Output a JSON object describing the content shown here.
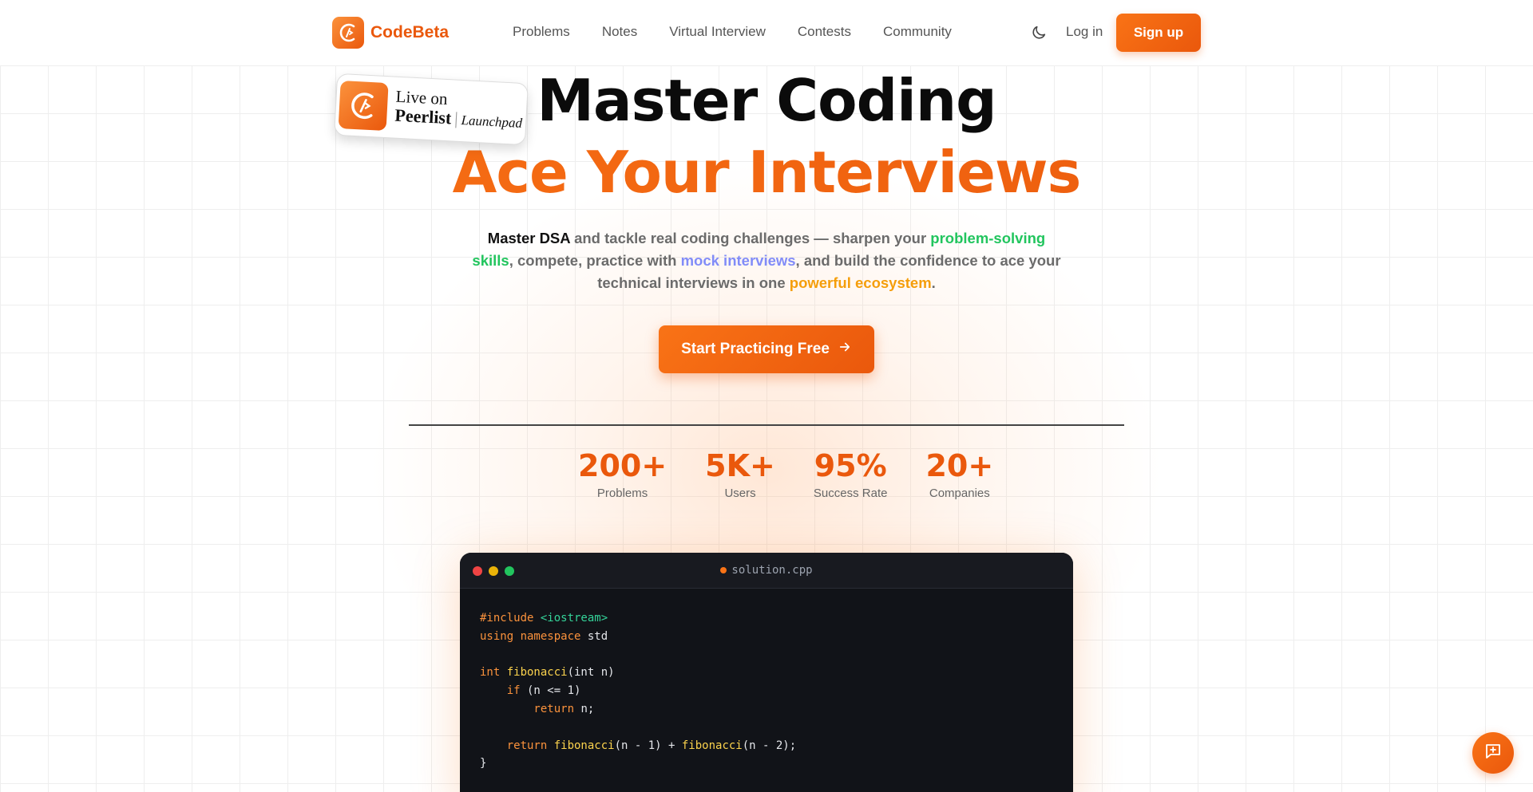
{
  "brand": {
    "name": "CodeBeta",
    "accent": "#ea580c"
  },
  "nav": {
    "links": [
      "Problems",
      "Notes",
      "Virtual Interview",
      "Contests",
      "Community"
    ],
    "theme_icon": "moon-icon",
    "login": "Log in",
    "signup": "Sign up"
  },
  "badge": {
    "line1": "Live on",
    "peerlist": "Peerlist",
    "launchpad": "Launchpad"
  },
  "hero": {
    "title_line1": "Master Coding",
    "title_line2": "Ace Your Interviews",
    "desc": {
      "p1": "Master DSA",
      "p2": " and tackle real coding challenges — sharpen your ",
      "p3": "problem-solving skills",
      "p4": ", compete, practice with ",
      "p5": "mock interviews",
      "p6": ", and build the confidence to ace your technical interviews in one ",
      "p7": "powerful ecosystem",
      "p8": "."
    },
    "cta": "Start Practicing Free"
  },
  "stats": [
    {
      "value": "200+",
      "label": "Problems"
    },
    {
      "value": "5K+",
      "label": "Users"
    },
    {
      "value": "95%",
      "label": "Success Rate"
    },
    {
      "value": "20+",
      "label": "Companies"
    }
  ],
  "editor": {
    "filename": "solution.cpp",
    "dots": [
      "#ef4444",
      "#eab308",
      "#22c55e"
    ],
    "code": {
      "l1a": "#include ",
      "l1b": "<iostream>",
      "l2a": "using namespace",
      "l2b": " std",
      "l4a": "int ",
      "l4b": "fibonacci",
      "l4c": "(int n)",
      "l5a": "    if",
      "l5b": " (n <= 1)",
      "l6a": "        return",
      "l6b": " n;",
      "l8a": "    return ",
      "l8b": "fibonacci",
      "l8c": "(n - 1) + ",
      "l8d": "fibonacci",
      "l8e": "(n - 2);",
      "l9": "}"
    }
  },
  "fab_icon": "chat-plus-icon"
}
